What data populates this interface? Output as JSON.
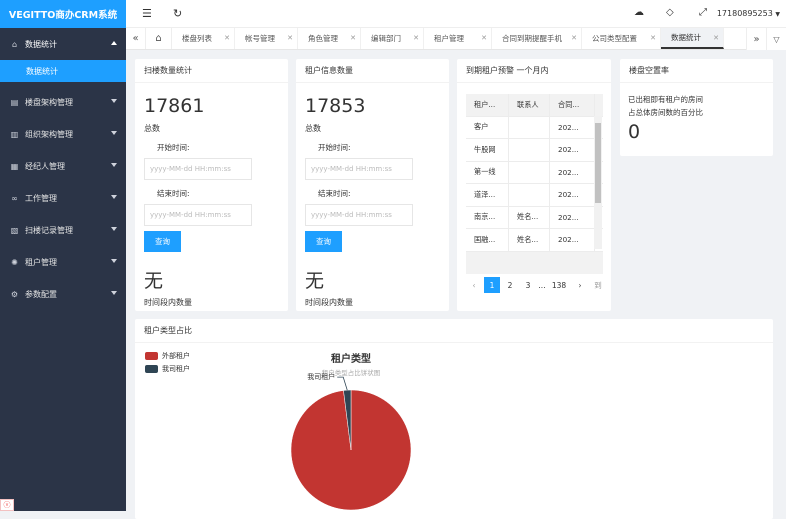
{
  "app": {
    "title": "VEGITTO商办CRM系统",
    "user": "17180895253"
  },
  "sidebar": {
    "items": [
      {
        "label": "数据统计",
        "icon": "home-icon"
      },
      {
        "label": "楼盘架构管理",
        "icon": "building-icon"
      },
      {
        "label": "组织架构管理",
        "icon": "org-icon"
      },
      {
        "label": "经纪人管理",
        "icon": "agent-icon"
      },
      {
        "label": "工作管理",
        "icon": "work-icon"
      },
      {
        "label": "扫楼记录管理",
        "icon": "record-icon"
      },
      {
        "label": "租户管理",
        "icon": "tenant-icon"
      },
      {
        "label": "参数配置",
        "icon": "gear-icon"
      }
    ],
    "sub_item": "数据统计",
    "footer_icon": "logo-mark"
  },
  "tabs": [
    "楼盘列表",
    "帐号管理",
    "角色管理",
    "编辑部门",
    "租户管理",
    "合同到期提醒手机",
    "公司类型配置",
    "数据统计"
  ],
  "cards": {
    "scan": {
      "title": "扫楼数量统计",
      "count": "17861",
      "count_label": "总数",
      "start_label": "开始时间:",
      "end_label": "结束时间:",
      "placeholder": "yyyy-MM-dd HH:mm:ss",
      "query": "查询",
      "none": "无",
      "period_label": "时间段内数量"
    },
    "tenant": {
      "title": "租户信息数量",
      "count": "17853",
      "count_label": "总数",
      "start_label": "开始时间:",
      "end_label": "结束时间:",
      "placeholder": "yyyy-MM-dd HH:mm:ss",
      "query": "查询",
      "none": "无",
      "period_label": "时间段内数量"
    },
    "expire": {
      "title": "到期租户预警 一个月内",
      "headers": [
        "租户...",
        "联系人",
        "合同..."
      ],
      "rows": [
        [
          "客户",
          "",
          "202..."
        ],
        [
          "牛股网",
          "",
          "202..."
        ],
        [
          "第一线",
          "",
          "202..."
        ],
        [
          "道泽...",
          "",
          "202..."
        ],
        [
          "南京...",
          "姓名...",
          "202..."
        ],
        [
          "国融...",
          "姓名...",
          "202..."
        ]
      ],
      "pager": {
        "prev": "‹",
        "pages": [
          "1",
          "2",
          "3"
        ],
        "ellipsis": "...",
        "last": "138",
        "next": "›",
        "goto": "到"
      }
    },
    "vacancy": {
      "title": "楼盘空置率",
      "desc1": "已出租即有租户的房间",
      "desc2": "占总体房间数的百分比",
      "value": "0"
    },
    "ratio": {
      "title": "租户类型占比"
    }
  },
  "chart_data": {
    "type": "pie",
    "title": "租户类型",
    "subtitle": "租户类型占比饼状图",
    "legend_position": "top-left",
    "labels": [
      "外部租户",
      "我司租户"
    ],
    "values": [
      98,
      2
    ],
    "colors": [
      "#c23531",
      "#2f4554"
    ]
  }
}
